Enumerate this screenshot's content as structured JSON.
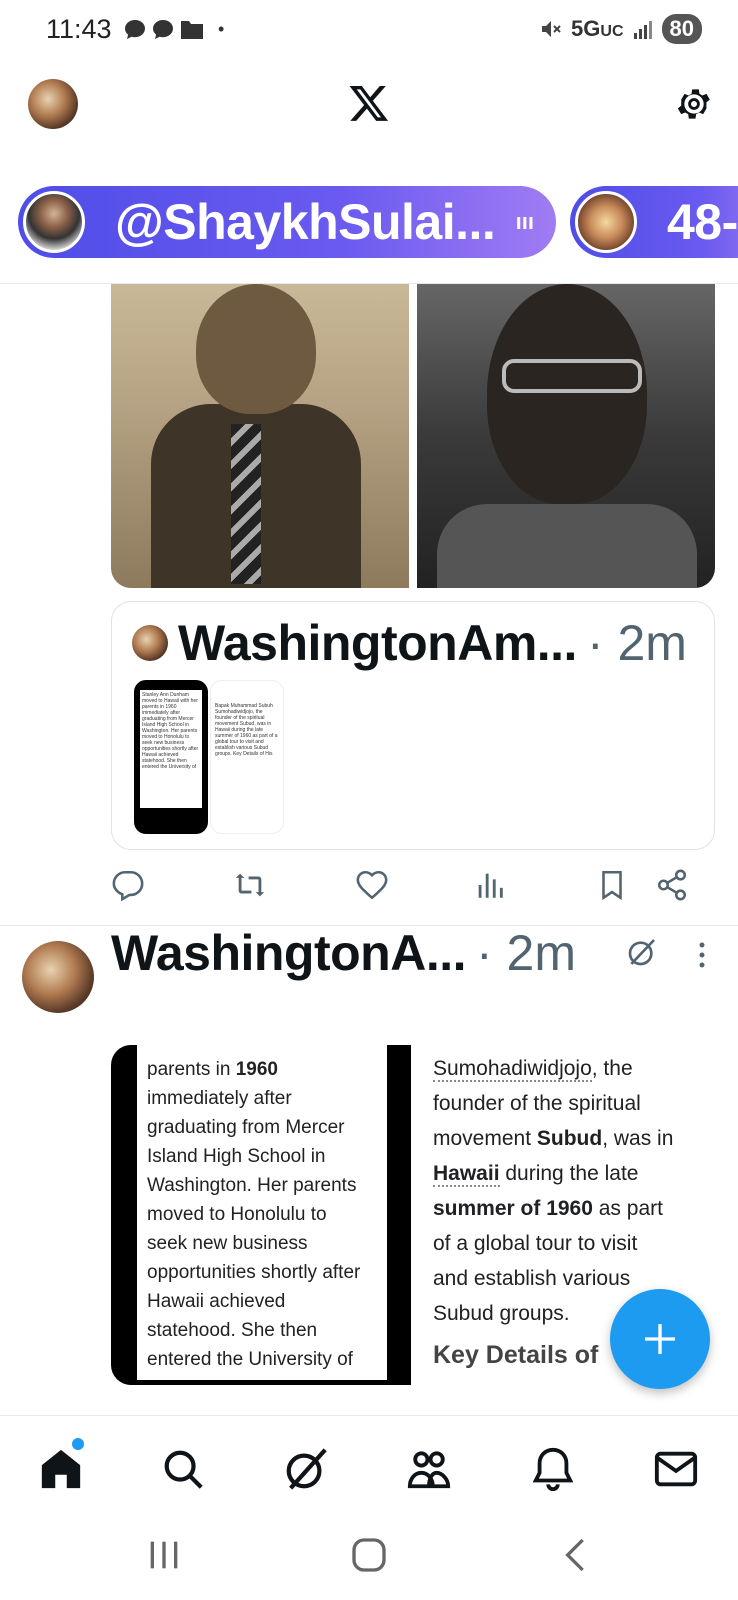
{
  "status_bar": {
    "time": "11:43",
    "network": "5G",
    "network_suffix": "UC",
    "battery": "80"
  },
  "header": {
    "logo": "x-logo",
    "settings_icon": "gear-icon"
  },
  "spaces": [
    {
      "label": "@ShaykhSulai...",
      "indicator": "ııı"
    },
    {
      "label": "48-"
    }
  ],
  "post1": {
    "quote": {
      "author": "WashingtonAm...",
      "time": "· 2m"
    }
  },
  "actions": [
    "reply-icon",
    "repost-icon",
    "like-icon",
    "views-icon",
    "bookmark-icon",
    "share-icon"
  ],
  "post2": {
    "author": "WashingtonA...",
    "time": "· 2m",
    "image1_lines": [
      {
        "pre": "parents in ",
        "bold": "1960",
        "post": ""
      },
      {
        "pre": "immediately after",
        "bold": "",
        "post": ""
      },
      {
        "pre": "graduating from Mercer",
        "bold": "",
        "post": ""
      },
      {
        "pre": "Island High School in",
        "bold": "",
        "post": ""
      },
      {
        "pre": "Washington. Her parents",
        "bold": "",
        "post": ""
      },
      {
        "pre": "moved to Honolulu to",
        "bold": "",
        "post": ""
      },
      {
        "pre": "seek new business",
        "bold": "",
        "post": ""
      },
      {
        "pre": "opportunities shortly after",
        "bold": "",
        "post": ""
      },
      {
        "pre": "Hawaii achieved",
        "bold": "",
        "post": ""
      },
      {
        "pre": "statehood. She then",
        "bold": "",
        "post": ""
      },
      {
        "pre": "entered the University of",
        "bold": "",
        "post": ""
      }
    ],
    "image2": {
      "line1_link": "Sumohadiwidjojo",
      "line1_rest": ", the",
      "line2": "founder of the spiritual",
      "line3_pre": "movement ",
      "line3_bold": "Subud",
      "line3_post": ", was in",
      "line4_bold": "Hawaii",
      "line4_post": " during the late",
      "line5_bold": "summer of 1960",
      "line5_post": " as part",
      "line6": "of a global tour to visit",
      "line7": "and establish various",
      "line8": "Subud groups.",
      "key_details": "Key Details of"
    }
  },
  "thumbs": {
    "thumb1_text": "Stanley Ann Dunham moved to Hawaii with her parents in 1960 immediately after graduating from Mercer Island High School in Washington. Her parents moved to Honolulu to seek new business opportunities shortly after Hawaii achieved statehood. She then entered the University of",
    "thumb2_text": "Bapak Muhammad Subuh Sumohadiwidjojo, the founder of the spiritual movement Subud, was in Hawaii during the late summer of 1960 as part of a global tour to visit and establish various Subud groups. Key Details of His"
  },
  "bottom_nav": [
    "home-icon",
    "search-icon",
    "grok-icon",
    "communities-icon",
    "notifications-icon",
    "messages-icon"
  ],
  "colors": {
    "accent": "#1d9bf0",
    "space_pill_start": "#4f4de8",
    "space_pill_end": "#a07cf2",
    "muted_text": "#536471"
  }
}
